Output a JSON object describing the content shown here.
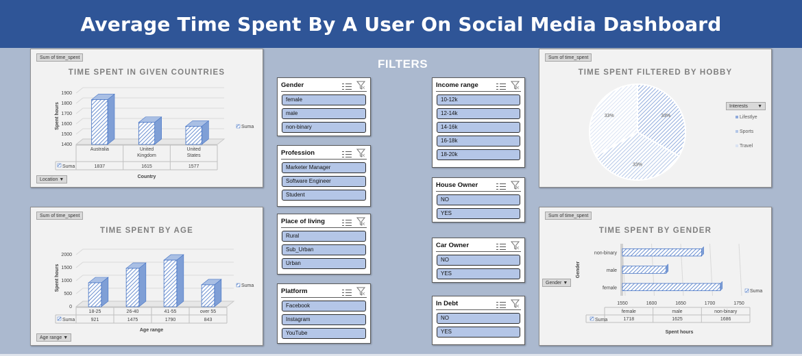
{
  "header": {
    "title": "Average Time Spent By A User On Social Media Dashboard"
  },
  "filters_label": "FILTERS",
  "colors": {
    "header_bg": "#2f5597",
    "page_bg": "#abb9cf",
    "bar_fill": "#b4c7e7",
    "bar_stroke": "#4472c4",
    "slicer_item": "#b4c6e7"
  },
  "icons": {
    "multiselect": "multi-select-icon",
    "clear": "clear-filter-icon",
    "dropdown": "dropdown-arrow-icon"
  },
  "slicers": {
    "gender": {
      "title": "Gender",
      "items": [
        "female",
        "male",
        "non-binary"
      ]
    },
    "profession": {
      "title": "Profession",
      "items": [
        "Marketer Manager",
        "Software Engineer",
        "Student"
      ]
    },
    "place": {
      "title": "Place of living",
      "items": [
        "Rural",
        "Sub_Urban",
        "Urban"
      ]
    },
    "platform": {
      "title": "Platform",
      "items": [
        "Facebook",
        "Instagram",
        "YouTube"
      ]
    },
    "income": {
      "title": "Income range",
      "items": [
        "10-12k",
        "12-14k",
        "14-16k",
        "16-18k",
        "18-20k"
      ]
    },
    "house": {
      "title": "House Owner",
      "items": [
        "NO",
        "YES"
      ]
    },
    "car": {
      "title": "Car Owner",
      "items": [
        "NO",
        "YES"
      ]
    },
    "debt": {
      "title": "In Debt",
      "items": [
        "NO",
        "YES"
      ]
    }
  },
  "chart_data": [
    {
      "id": "countries",
      "type": "bar",
      "title": "TIME SPENT IN GIVEN COUNTRIES",
      "field_button": "Sum of time_spent",
      "axis_button": "Location",
      "xlabel": "Country",
      "ylabel": "Spent hours",
      "categories": [
        [
          "Australia"
        ],
        [
          "United",
          "Kingdom"
        ],
        [
          "United",
          "States"
        ]
      ],
      "series": [
        {
          "name": "Suma",
          "values": [
            1837,
            1615,
            1577
          ]
        }
      ],
      "ylim": [
        1400,
        1900
      ],
      "yticks": [
        1400,
        1500,
        1600,
        1700,
        1800,
        1900
      ],
      "grid": true,
      "legend": "right",
      "table_label": "Suma",
      "table_values": [
        "1837",
        "1615",
        "1577"
      ]
    },
    {
      "id": "age",
      "type": "bar",
      "title": "TIME SPENT BY AGE",
      "field_button": "Sum of time_spent",
      "axis_button": "Age range",
      "xlabel": "Age range",
      "ylabel": "Spent hours",
      "categories": [
        [
          "18-25"
        ],
        [
          "26-40"
        ],
        [
          "41-55"
        ],
        [
          "over 55"
        ]
      ],
      "series": [
        {
          "name": "Suma",
          "values": [
            921,
            1475,
            1790,
            843
          ]
        }
      ],
      "ylim": [
        0,
        2000
      ],
      "yticks": [
        0,
        500,
        1000,
        1500,
        2000
      ],
      "grid": true,
      "legend": "right",
      "table_label": "Suma",
      "table_values": [
        "921",
        "1475",
        "1790",
        "843"
      ]
    },
    {
      "id": "hobby",
      "type": "pie",
      "title": "TIME SPENT FILTERED BY HOBBY",
      "field_button": "Sum of time_spent",
      "legend_button": "Interests",
      "categories": [
        "Lifestlye",
        "Sports",
        "Travel"
      ],
      "values": [
        33,
        33,
        33
      ],
      "labels": [
        "33%",
        "33%",
        "33%"
      ],
      "legend": "right"
    },
    {
      "id": "gender",
      "type": "bar",
      "orientation": "horizontal",
      "title": "TIME SPENT BY GENDER",
      "field_button": "Sum of time_spent",
      "axis_button": "Gender",
      "xlabel": "Spent hours",
      "ylabel": "Gender",
      "categories": [
        "female",
        "male",
        "non-binary"
      ],
      "series": [
        {
          "name": "Suma",
          "values": [
            1718,
            1625,
            1686
          ]
        }
      ],
      "xlim": [
        1550,
        1750
      ],
      "xticks": [
        1550,
        1600,
        1650,
        1700,
        1750
      ],
      "grid": true,
      "legend": "right",
      "table_label": "Suma",
      "table_values": [
        "1718",
        "1625",
        "1686"
      ]
    }
  ]
}
